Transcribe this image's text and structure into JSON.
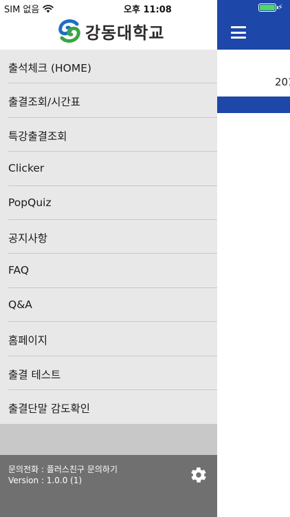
{
  "status_bar": {
    "carrier": "SIM 없음",
    "time": "오후 11:08",
    "wifi_icon": "wifi-icon",
    "battery_icon": "battery-charging-icon"
  },
  "drawer": {
    "logo_text": "강동대학교",
    "logo_icon": "kangdong-university-logo-icon",
    "menu": [
      {
        "label": "출석체크 (HOME)"
      },
      {
        "label": "출결조회/시간표"
      },
      {
        "label": "특강출결조회"
      },
      {
        "label": "Clicker"
      },
      {
        "label": "PopQuiz"
      },
      {
        "label": "공지사항"
      },
      {
        "label": "FAQ"
      },
      {
        "label": "Q&A"
      },
      {
        "label": "홈페이지"
      },
      {
        "label": "출결 테스트"
      },
      {
        "label": "출결단말 감도확인"
      }
    ],
    "footer": {
      "contact": "문의전화 :  플러스친구 문의하기",
      "version": "Version :  1.0.0 (1)",
      "settings_icon": "gear-icon"
    }
  },
  "background_app": {
    "menu_icon": "hamburger-menu-icon",
    "partial_text": "201"
  },
  "colors": {
    "navbar_blue": "#1d47a8",
    "drawer_bg": "#e8e8e8",
    "footer_bg": "#707070",
    "battery_green": "#4cd964"
  }
}
